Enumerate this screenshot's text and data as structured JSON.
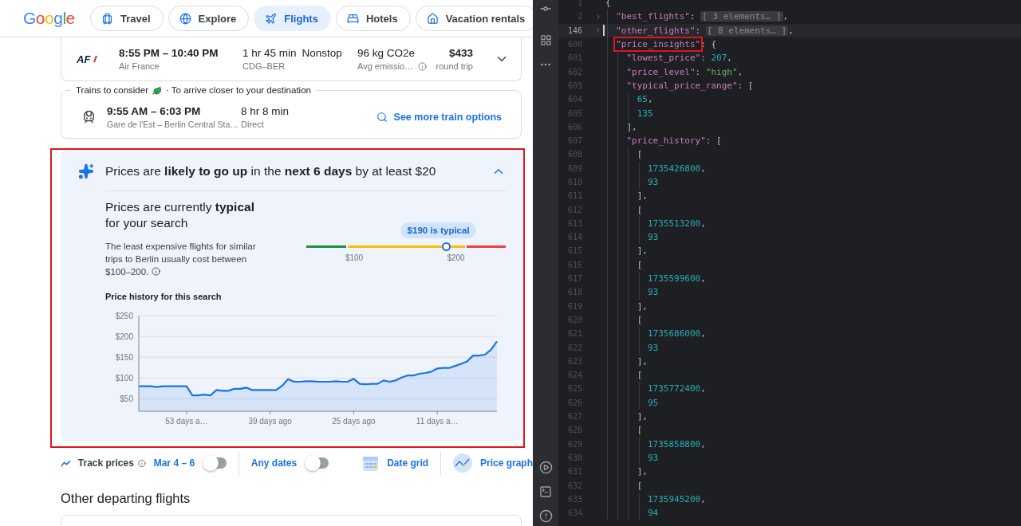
{
  "header": {
    "logo": "Google",
    "nav": [
      {
        "label": "Travel",
        "kind": "travel",
        "selected": false
      },
      {
        "label": "Explore",
        "kind": "explore",
        "selected": false
      },
      {
        "label": "Flights",
        "kind": "flights",
        "selected": true
      },
      {
        "label": "Hotels",
        "kind": "hotels",
        "selected": false
      },
      {
        "label": "Vacation rentals",
        "kind": "rentals",
        "selected": false
      }
    ]
  },
  "flight": {
    "airline_logo": "AF",
    "times": "8:55 PM – 10:40 PM",
    "airline": "Air France",
    "duration": "1 hr 45 min",
    "stops": "Nonstop",
    "route": "CDG–BER",
    "emissions": "96 kg CO2e",
    "emissions_note": "Avg emissio…",
    "price": "$433",
    "price_note": "round trip",
    "expanded": false
  },
  "trains": {
    "title": "Trains to consider",
    "subtitle": "· To arrive closer to your destination",
    "times": "9:55 AM – 6:03 PM",
    "stations": "Gare de l'Est – Berlin Central Sta…",
    "duration": "8 hr 8 min",
    "stops": "Direct",
    "link": "See more train options"
  },
  "price_insights": {
    "highlighted": true,
    "expanded": true,
    "headline": "Prices are **likely to go up** in the **next 6 days** by at least $20",
    "status": "Prices are currently **typical** for your search",
    "description": "The least expensive flights for similar trips to Berlin usually cost between $100–200.",
    "range": {
      "tooltip": "$190 is typical",
      "level": 0.7,
      "labels": [
        "$100",
        "$200"
      ]
    },
    "history_title": "Price history for this search",
    "chart_data": {
      "type": "area",
      "grid": true,
      "x": [
        -61,
        -60,
        -59,
        -58,
        -57,
        -56,
        -55,
        -54,
        -53,
        -52,
        -51,
        -50,
        -49,
        -48,
        -47,
        -46,
        -45,
        -44,
        -43,
        -42,
        -41,
        -40,
        -39,
        -38,
        -37,
        -36,
        -35,
        -34,
        -33,
        -32,
        -31,
        -30,
        -29,
        -28,
        -27,
        -26,
        -25,
        -24,
        -23,
        -22,
        -21,
        -20,
        -19,
        -18,
        -17,
        -16,
        -15,
        -14,
        -13,
        -12,
        -11,
        -10,
        -9,
        -8,
        -7,
        -6,
        -5,
        -4,
        -3,
        -2,
        -1
      ],
      "series": [
        {
          "color": "#1a73e8",
          "values": [
            80,
            80,
            80,
            78,
            80,
            80,
            80,
            80,
            80,
            58,
            58,
            60,
            58,
            71,
            69,
            69,
            74,
            74,
            77,
            71,
            71,
            71,
            71,
            71,
            81,
            97,
            91,
            91,
            92,
            92,
            91,
            91,
            91,
            92,
            91,
            91,
            98,
            86,
            85,
            86,
            86,
            94,
            91,
            94,
            101,
            106,
            106,
            110,
            112,
            115,
            123,
            124,
            124,
            129,
            134,
            140,
            154,
            154,
            156,
            168,
            188
          ]
        }
      ],
      "xlim": [
        -61,
        -1
      ],
      "ylim": [
        20,
        250
      ],
      "xticks": [
        {
          "value": -53,
          "label": "53 days a…"
        },
        {
          "value": -39,
          "label": "39 days ago"
        },
        {
          "value": -25,
          "label": "25 days ago"
        },
        {
          "value": -11,
          "label": "11 days a…"
        }
      ],
      "yticks": [
        {
          "value": 50,
          "label": "$50"
        },
        {
          "value": 100,
          "label": "$100"
        },
        {
          "value": 150,
          "label": "$150"
        },
        {
          "value": 200,
          "label": "$200"
        },
        {
          "value": 250,
          "label": "$250"
        }
      ]
    }
  },
  "tracking": {
    "label": "Track prices",
    "dates": "Mar 4 – 6",
    "dates_on": false,
    "any_dates": "Any dates",
    "any_dates_on": false,
    "date_grid": "Date grid",
    "price_graph": "Price graph"
  },
  "other_flights": {
    "title": "Other departing flights"
  },
  "editor": {
    "lines": [
      {
        "number": "1",
        "tokens": [
          {
            "kind": "punct",
            "text": "{"
          }
        ],
        "children": [
          {
            "number": "2",
            "folded": true,
            "tokens": [
              {
                "kind": "key",
                "text": "\"best_flights\""
              },
              {
                "kind": "punct",
                "text": ": "
              },
              {
                "kind": "fold",
                "text": "[ 3 elements… ]"
              },
              {
                "kind": "punct",
                "text": ","
              }
            ]
          },
          {
            "number": "146",
            "folded": true,
            "current": true,
            "tokens": [
              {
                "kind": "key",
                "text": "\"other_flights\""
              },
              {
                "kind": "punct",
                "text": ": "
              },
              {
                "kind": "fold",
                "text": "[ 8 elements… ]"
              },
              {
                "kind": "punct",
                "text": ","
              }
            ]
          },
          {
            "number": "600",
            "highlighted": true,
            "tokens": [
              {
                "kind": "key",
                "text": "\"price_insights\""
              },
              {
                "kind": "punct",
                "text": ": {"
              }
            ],
            "children": [
              {
                "number": "601",
                "tokens": [
                  {
                    "kind": "key",
                    "text": "\"lowest_price\""
                  },
                  {
                    "kind": "punct",
                    "text": ": "
                  },
                  {
                    "kind": "number",
                    "text": "207"
                  },
                  {
                    "kind": "punct",
                    "text": ","
                  }
                ]
              },
              {
                "number": "602",
                "tokens": [
                  {
                    "kind": "key",
                    "text": "\"price_level\""
                  },
                  {
                    "kind": "punct",
                    "text": ": "
                  },
                  {
                    "kind": "string",
                    "text": "\"high\""
                  },
                  {
                    "kind": "punct",
                    "text": ","
                  }
                ]
              },
              {
                "number": "603",
                "tokens": [
                  {
                    "kind": "key",
                    "text": "\"typical_price_range\""
                  },
                  {
                    "kind": "punct",
                    "text": ": ["
                  }
                ],
                "children": [
                  {
                    "number": "604",
                    "tokens": [
                      {
                        "kind": "number",
                        "text": "65"
                      },
                      {
                        "kind": "punct",
                        "text": ","
                      }
                    ]
                  },
                  {
                    "number": "605",
                    "tokens": [
                      {
                        "kind": "number",
                        "text": "135"
                      }
                    ]
                  }
                ]
              },
              {
                "number": "606",
                "tokens": [
                  {
                    "kind": "punct",
                    "text": "],"
                  }
                ]
              },
              {
                "number": "607",
                "tokens": [
                  {
                    "kind": "key",
                    "text": "\"price_history\""
                  },
                  {
                    "kind": "punct",
                    "text": ": ["
                  }
                ],
                "children": [
                  {
                    "number": "608",
                    "tokens": [
                      {
                        "kind": "punct",
                        "text": "["
                      }
                    ],
                    "children": [
                      {
                        "number": "609",
                        "tokens": [
                          {
                            "kind": "number",
                            "text": "1735426800"
                          },
                          {
                            "kind": "punct",
                            "text": ","
                          }
                        ]
                      },
                      {
                        "number": "610",
                        "tokens": [
                          {
                            "kind": "number",
                            "text": "93"
                          }
                        ]
                      }
                    ]
                  },
                  {
                    "number": "611",
                    "tokens": [
                      {
                        "kind": "punct",
                        "text": "],"
                      }
                    ]
                  },
                  {
                    "number": "612",
                    "tokens": [
                      {
                        "kind": "punct",
                        "text": "["
                      }
                    ],
                    "children": [
                      {
                        "number": "613",
                        "tokens": [
                          {
                            "kind": "number",
                            "text": "1735513200"
                          },
                          {
                            "kind": "punct",
                            "text": ","
                          }
                        ]
                      },
                      {
                        "number": "614",
                        "tokens": [
                          {
                            "kind": "number",
                            "text": "93"
                          }
                        ]
                      }
                    ]
                  },
                  {
                    "number": "615",
                    "tokens": [
                      {
                        "kind": "punct",
                        "text": "],"
                      }
                    ]
                  },
                  {
                    "number": "616",
                    "tokens": [
                      {
                        "kind": "punct",
                        "text": "["
                      }
                    ],
                    "children": [
                      {
                        "number": "617",
                        "tokens": [
                          {
                            "kind": "number",
                            "text": "1735599600"
                          },
                          {
                            "kind": "punct",
                            "text": ","
                          }
                        ]
                      },
                      {
                        "number": "618",
                        "tokens": [
                          {
                            "kind": "number",
                            "text": "93"
                          }
                        ]
                      }
                    ]
                  },
                  {
                    "number": "619",
                    "tokens": [
                      {
                        "kind": "punct",
                        "text": "],"
                      }
                    ]
                  },
                  {
                    "number": "620",
                    "tokens": [
                      {
                        "kind": "punct",
                        "text": "["
                      }
                    ],
                    "children": [
                      {
                        "number": "621",
                        "tokens": [
                          {
                            "kind": "number",
                            "text": "1735686000"
                          },
                          {
                            "kind": "punct",
                            "text": ","
                          }
                        ]
                      },
                      {
                        "number": "622",
                        "tokens": [
                          {
                            "kind": "number",
                            "text": "93"
                          }
                        ]
                      }
                    ]
                  },
                  {
                    "number": "623",
                    "tokens": [
                      {
                        "kind": "punct",
                        "text": "],"
                      }
                    ]
                  },
                  {
                    "number": "624",
                    "tokens": [
                      {
                        "kind": "punct",
                        "text": "["
                      }
                    ],
                    "children": [
                      {
                        "number": "625",
                        "tokens": [
                          {
                            "kind": "number",
                            "text": "1735772400"
                          },
                          {
                            "kind": "punct",
                            "text": ","
                          }
                        ]
                      },
                      {
                        "number": "626",
                        "tokens": [
                          {
                            "kind": "number",
                            "text": "95"
                          }
                        ]
                      }
                    ]
                  },
                  {
                    "number": "627",
                    "tokens": [
                      {
                        "kind": "punct",
                        "text": "],"
                      }
                    ]
                  },
                  {
                    "number": "628",
                    "tokens": [
                      {
                        "kind": "punct",
                        "text": "["
                      }
                    ],
                    "children": [
                      {
                        "number": "629",
                        "tokens": [
                          {
                            "kind": "number",
                            "text": "1735858800"
                          },
                          {
                            "kind": "punct",
                            "text": ","
                          }
                        ]
                      },
                      {
                        "number": "630",
                        "tokens": [
                          {
                            "kind": "number",
                            "text": "93"
                          }
                        ]
                      }
                    ]
                  },
                  {
                    "number": "631",
                    "tokens": [
                      {
                        "kind": "punct",
                        "text": "],"
                      }
                    ]
                  },
                  {
                    "number": "632",
                    "tokens": [
                      {
                        "kind": "punct",
                        "text": "["
                      }
                    ],
                    "children": [
                      {
                        "number": "633",
                        "tokens": [
                          {
                            "kind": "number",
                            "text": "1735945200"
                          },
                          {
                            "kind": "punct",
                            "text": ","
                          }
                        ]
                      },
                      {
                        "number": "634",
                        "tokens": [
                          {
                            "kind": "number",
                            "text": "94"
                          }
                        ]
                      }
                    ]
                  }
                ]
              }
            ]
          }
        ]
      }
    ]
  }
}
